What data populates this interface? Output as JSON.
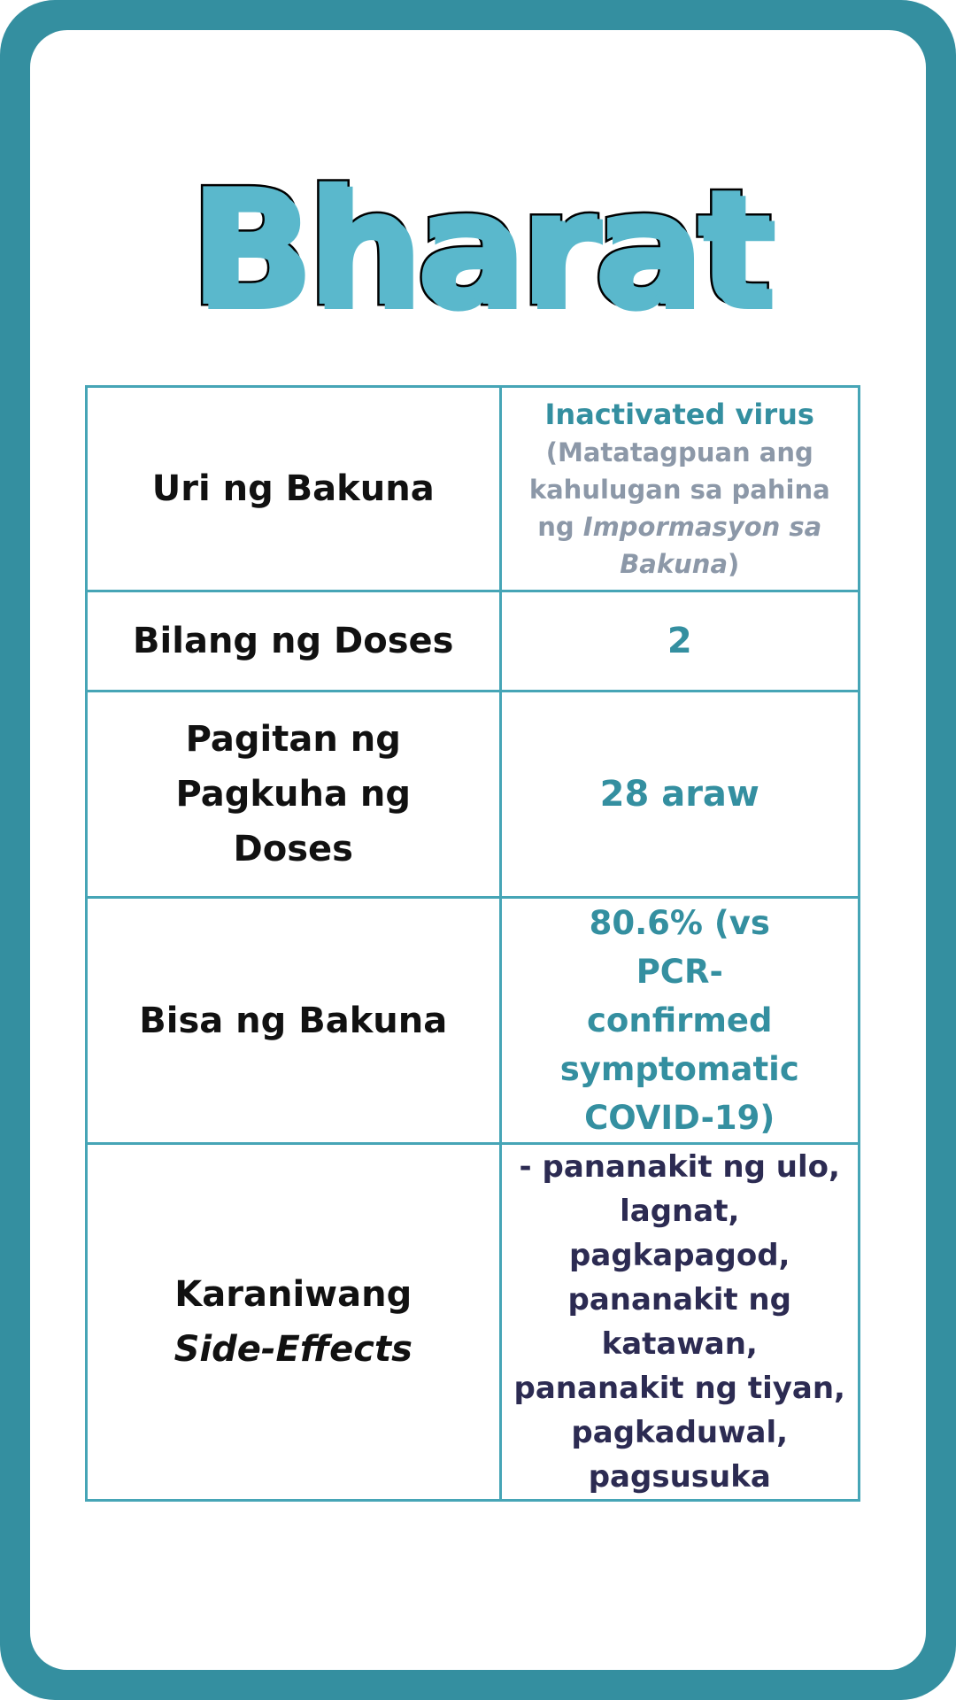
{
  "title": "Bharat",
  "colors": {
    "frame": "#348fa0",
    "title_fill": "#5ab8cc",
    "value_text": "#348fa0",
    "note_text": "#8c98a8",
    "side_effects_text": "#2c2b52",
    "table_border": "#46a5b6"
  },
  "rows": [
    {
      "label": "Uri ng Bakuna",
      "value_main": "Inactivated virus",
      "value_note_start": "(Matatagpuan ang kahulugan sa pahina ng ",
      "value_note_italic": "Impormasyon sa Bakuna",
      "value_note_end": ")"
    },
    {
      "label": "Bilang ng Doses",
      "value": "2"
    },
    {
      "label": "Pagitan ng Pagkuha ng Doses",
      "value": "28 araw"
    },
    {
      "label": "Bisa ng Bakuna",
      "value": "80.6% (vs PCR-confirmed symptomatic COVID-19)"
    },
    {
      "label_line1": "Karaniwang",
      "label_line2": "Side-Effects",
      "value": "- pananakit ng ulo, lagnat, pagkapagod, pananakit ng katawan, pananakit ng tiyan, pagkaduwal, pagsusuka"
    }
  ]
}
